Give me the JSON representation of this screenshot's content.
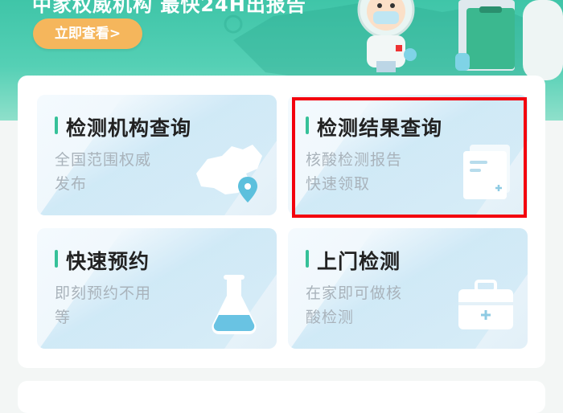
{
  "banner": {
    "title": "中家权威机构 最快24H出报告",
    "view_button": "立即查看>",
    "colors": {
      "bg": "#46c8ab",
      "button": "#f5b65c"
    }
  },
  "cards": [
    {
      "title": "检测机构查询",
      "desc_lines": [
        "全国范围权威",
        "发布"
      ],
      "icon": "china-map-pin-icon"
    },
    {
      "title": "检测结果查询",
      "desc_lines": [
        "核酸检测报告",
        "快速领取"
      ],
      "icon": "report-document-icon",
      "highlighted": true
    },
    {
      "title": "快速预约",
      "desc_lines": [
        "即刻预约不用",
        "等"
      ],
      "icon": "flask-icon"
    },
    {
      "title": "上门检测",
      "desc_lines": [
        "在家即可做核",
        "酸检测"
      ],
      "icon": "medical-kit-icon"
    }
  ],
  "colors": {
    "accent": "#36c199",
    "highlight": "#f3000e",
    "desc": "#a9b3bb"
  }
}
